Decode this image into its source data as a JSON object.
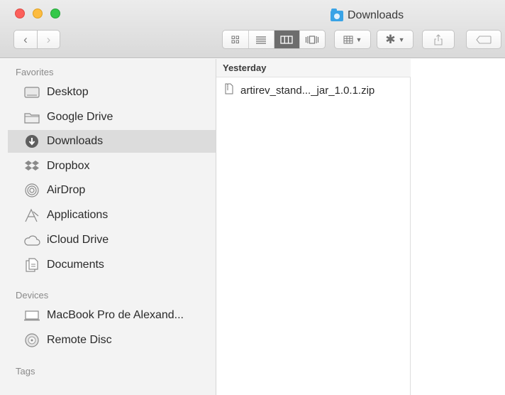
{
  "window": {
    "title": "Downloads",
    "title_icon": "downloads-folder-icon"
  },
  "toolbar": {
    "back_icon": "‹",
    "forward_icon": "›",
    "view_modes": [
      "icon-view",
      "list-view",
      "column-view",
      "cover-flow-view"
    ],
    "active_view": "column-view",
    "arrange_icon": "arrange-grid-icon",
    "action_icon": "gear-icon",
    "share_icon": "share-icon",
    "tag_icon": "tag-icon"
  },
  "sidebar": {
    "favorites_label": "Favorites",
    "favorites": [
      {
        "label": "Desktop",
        "icon": "desktop-icon"
      },
      {
        "label": "Google Drive",
        "icon": "folder-icon"
      },
      {
        "label": "Downloads",
        "icon": "downloads-icon",
        "selected": true
      },
      {
        "label": "Dropbox",
        "icon": "dropbox-icon"
      },
      {
        "label": "AirDrop",
        "icon": "airdrop-icon"
      },
      {
        "label": "Applications",
        "icon": "applications-icon"
      },
      {
        "label": "iCloud Drive",
        "icon": "cloud-icon"
      },
      {
        "label": "Documents",
        "icon": "documents-icon"
      }
    ],
    "devices_label": "Devices",
    "devices": [
      {
        "label": "MacBook Pro de Alexand...",
        "icon": "laptop-icon"
      },
      {
        "label": "Remote Disc",
        "icon": "disc-icon"
      }
    ],
    "tags_label": "Tags"
  },
  "column": {
    "header": "Yesterday",
    "files": [
      {
        "name": "artirev_stand..._jar_1.0.1.zip",
        "icon": "zip-file-icon"
      }
    ]
  },
  "colors": {
    "accent_folder": "#39a3e6",
    "selected_row": "#dcdcdc",
    "sidebar_bg": "#f3f3f3"
  }
}
